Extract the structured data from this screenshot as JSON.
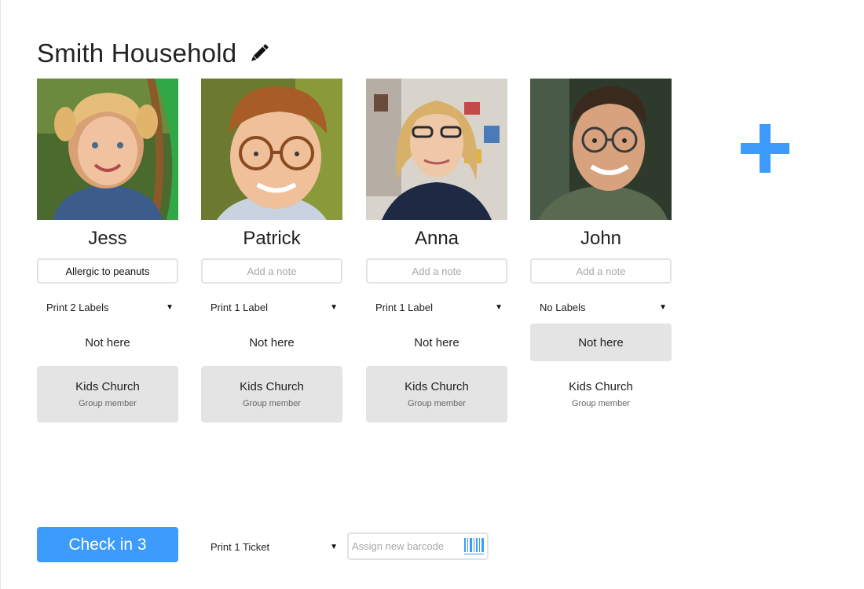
{
  "household": {
    "title": "Smith Household",
    "edit_icon": "pencil-icon"
  },
  "people": [
    {
      "name": "Jess",
      "note_value": "Allergic to peanuts",
      "note_placeholder": "Add a note",
      "labels_option": "Print 2 Labels",
      "status": "Not here",
      "status_active": false,
      "group_name": "Kids Church",
      "group_role": "Group member",
      "group_selected": true
    },
    {
      "name": "Patrick",
      "note_value": "",
      "note_placeholder": "Add a note",
      "labels_option": "Print 1 Label",
      "status": "Not here",
      "status_active": false,
      "group_name": "Kids Church",
      "group_role": "Group member",
      "group_selected": true
    },
    {
      "name": "Anna",
      "note_value": "",
      "note_placeholder": "Add a note",
      "labels_option": "Print 1 Label",
      "status": "Not here",
      "status_active": false,
      "group_name": "Kids Church",
      "group_role": "Group member",
      "group_selected": true
    },
    {
      "name": "John",
      "note_value": "",
      "note_placeholder": "Add a note",
      "labels_option": "No Labels",
      "status": "Not here",
      "status_active": true,
      "group_name": "Kids Church",
      "group_role": "Group member",
      "group_selected": false
    }
  ],
  "add_person": {
    "icon": "plus-icon",
    "color": "#3c9bfb"
  },
  "footer": {
    "checkin_label": "Check in 3",
    "ticket_option": "Print 1 Ticket",
    "barcode_placeholder": "Assign new barcode",
    "barcode_icon": "barcode-icon"
  },
  "colors": {
    "accent": "#3c9bfb",
    "selected_bg": "#e4e4e4",
    "border": "#e3e3e3"
  }
}
